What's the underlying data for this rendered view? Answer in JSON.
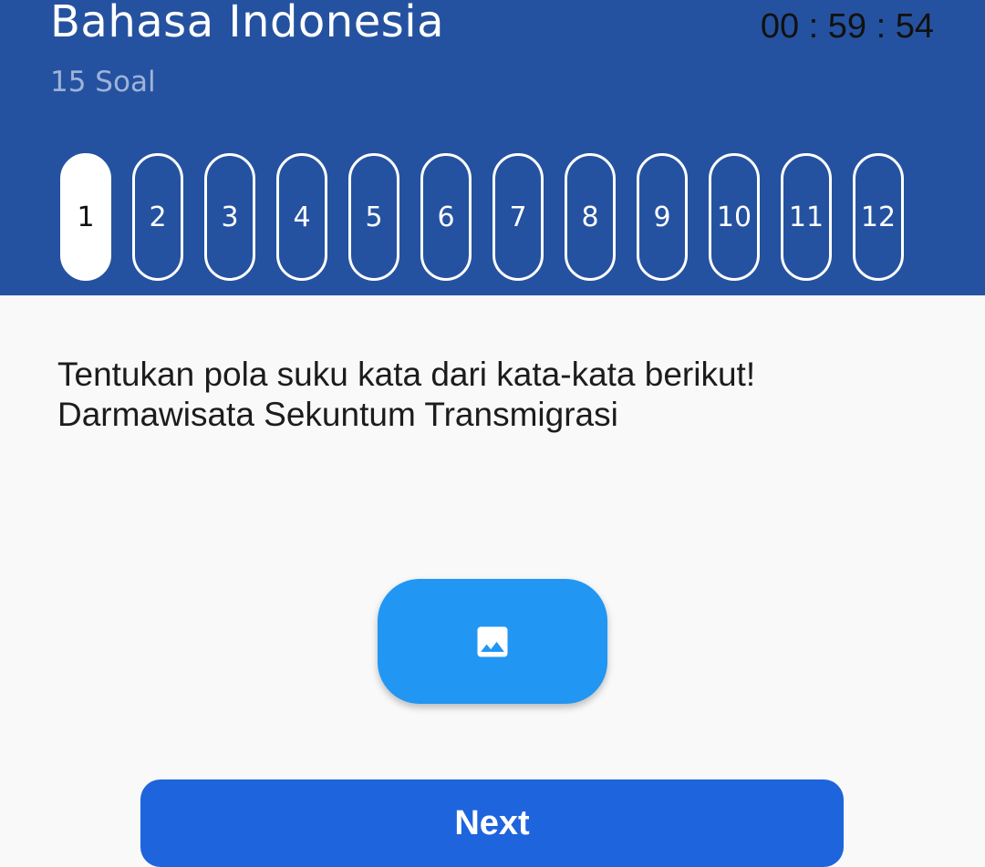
{
  "header": {
    "title": "Bahasa Indonesia",
    "subtitle": "15 Soal",
    "timer": "00 : 59 : 54",
    "background_color": "#2552a0"
  },
  "question_pager": {
    "items": [
      "1",
      "2",
      "3",
      "4",
      "5",
      "6",
      "7",
      "8",
      "9",
      "10",
      "11",
      "12"
    ],
    "active_index": 0
  },
  "question": {
    "line1": "Tentukan pola suku kata dari kata-kata berikut!",
    "line2": "Darmawisata Sekuntum Transmigrasi"
  },
  "image_button": {
    "icon": "image-icon",
    "color": "#2196f3"
  },
  "next_button": {
    "label": "Next",
    "color": "#1e64dc"
  }
}
